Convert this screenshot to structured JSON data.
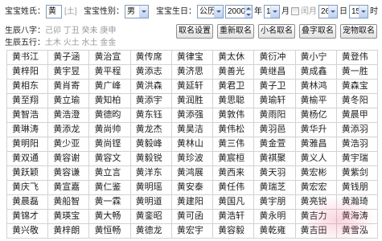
{
  "form": {
    "surname_label": "宝宝姓氏：",
    "surname_value": "黄",
    "surname_element": "[土]",
    "gender_label": "宝宝性别：",
    "gender_value": "男",
    "birthday_label": "宝宝生日：",
    "calendar_value": "公历",
    "year_value": "2000",
    "year_unit": "年",
    "month_value": "1",
    "month_unit": "月",
    "leap_month_label": "闰月",
    "leap_month_checked": false,
    "day_value": "26",
    "day_unit": "日",
    "hour_value": "15",
    "hour_unit": "时"
  },
  "bazi": {
    "label": "生辰八字：",
    "value": "己卯 丁丑 癸未 庚申"
  },
  "wuxing": {
    "label": "生辰五行：",
    "value": "土木 火土 水土 金金"
  },
  "buttons": [
    "取名设置",
    "重新取名",
    "小名取名",
    "叠字取名",
    "宠物取名"
  ],
  "names": [
    [
      "黄书江",
      "黄子涵",
      "黄治宣",
      "黄传席",
      "黄律宝",
      "黄太休",
      "黄衍冲",
      "黄小宁",
      "黄登伟"
    ],
    [
      "黄梓阳",
      "黄宇昱",
      "黄平程",
      "黄添志",
      "黄济思",
      "黄善光",
      "黄继昌",
      "黄成鑫",
      "黄一胜"
    ],
    [
      "黄相东",
      "黄肖寄",
      "黄广峰",
      "黄洪森",
      "黄延轩",
      "黄君卫",
      "黄子卫",
      "黄林鸿",
      "黄森宝"
    ],
    [
      "黄至翔",
      "黄立瑜",
      "黄知柏",
      "黄添宇",
      "黄润胜",
      "黄思聪",
      "黄瑜轩",
      "黄榆平",
      "黄冬阳"
    ],
    [
      "黄智浩",
      "黄浩澄",
      "黄德昀",
      "黄东钰",
      "黄添强",
      "黄敦伟",
      "黄雨阳",
      "黄杨亿",
      "黄晨甲"
    ],
    [
      "黄琳涛",
      "黄添龙",
      "黄尚帅",
      "黄龙杰",
      "黄昊洁",
      "黄伟松",
      "黄羽邑",
      "黄华升",
      "黄添羽"
    ],
    [
      "黄明阳",
      "黄少亚",
      "黄尚铿",
      "黄毅峰",
      "黄林山",
      "黄三伟",
      "黄金萱",
      "黄雅昌",
      "黄浩羽"
    ],
    [
      "黄双通",
      "黄容谢",
      "黄容文",
      "黄毅锐",
      "黄珍波",
      "黄宸桓",
      "黄祺聚",
      "黄义人",
      "黄宇瑞"
    ],
    [
      "黄跃颖",
      "黄容谦",
      "黄立言",
      "黄洋东",
      "黄鸿展",
      "黄西来",
      "黄天羽",
      "黄宏彬",
      "黄紫剑"
    ],
    [
      "黄庆飞",
      "黄宣嘉",
      "黄仁鉴",
      "黄明瑶",
      "黄安泰",
      "黄任伟",
      "黄瑞芝",
      "黄宏宏",
      "黄钱朋"
    ],
    [
      "黄晨磊",
      "黄船智",
      "黄一霖",
      "黄明道",
      "黄建阳",
      "黄国凡",
      "黄宇朋",
      "黄亮锐",
      "黄瀚琦"
    ],
    [
      "黄锦才",
      "黄瑛宝",
      "黄大畅",
      "黄銮昭",
      "黄可函",
      "黄浩轩",
      "黄永明",
      "黄吉力",
      "黄海涛"
    ],
    [
      "黄兴敬",
      "黄梓朗",
      "黄恒畅",
      "黄德龙",
      "黄宏宇",
      "黄容毅",
      "黄乾雍",
      "黄吉田",
      "黄雪泓"
    ]
  ],
  "icons": {
    "select_arrow": "chevron-down-icon",
    "spinner_up": "spinner-up-icon",
    "spinner_down": "spinner-down-icon",
    "checkbox": "checkbox-icon"
  },
  "colors": {
    "field_border": "#7f9db9",
    "muted_text": "#9a9a9a",
    "grid_line": "#d2d2d2",
    "button_border": "#8e8e8e"
  }
}
